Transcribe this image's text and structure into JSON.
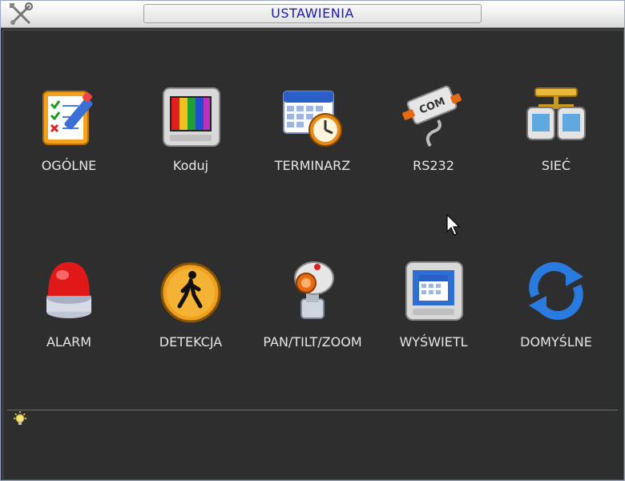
{
  "window": {
    "title": "USTAWIENIA"
  },
  "menu": {
    "items": [
      {
        "label": "OGÓLNE",
        "icon": "general-checklist-icon"
      },
      {
        "label": "Koduj",
        "icon": "encode-monitor-icon"
      },
      {
        "label": "TERMINARZ",
        "icon": "schedule-calendar-icon"
      },
      {
        "label": "RS232",
        "icon": "com-port-icon"
      },
      {
        "label": "SIEĆ",
        "icon": "network-icon"
      },
      {
        "label": "ALARM",
        "icon": "alarm-siren-icon"
      },
      {
        "label": "DETEKCJA",
        "icon": "detection-walker-icon"
      },
      {
        "label": "PAN/TILT/ZOOM",
        "icon": "ptz-camera-icon"
      },
      {
        "label": "WYŚWIETL",
        "icon": "display-monitor-icon"
      },
      {
        "label": "DOMYŚLNE",
        "icon": "default-refresh-icon"
      }
    ]
  },
  "status": {
    "tip_icon": "lightbulb-icon"
  },
  "colors": {
    "title_text": "#1a1aa8",
    "background": "#2e2e2e",
    "label_text": "#e6e6e6"
  }
}
